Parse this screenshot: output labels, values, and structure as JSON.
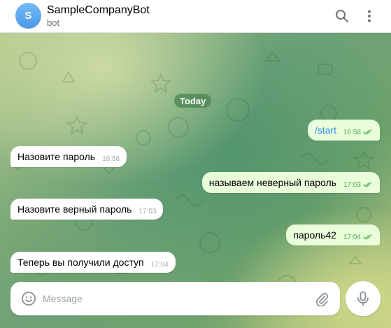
{
  "header": {
    "avatar_letter": "S",
    "title": "SampleCompanyBot",
    "subtitle": "bot",
    "icons": [
      "search-icon",
      "more-vertical-icon"
    ]
  },
  "chat": {
    "date_label": "Today",
    "messages": [
      {
        "dir": "out",
        "text": "/start",
        "time": "16:58",
        "status": "read"
      },
      {
        "dir": "in",
        "text": "Назовите пароль",
        "time": "16:58"
      },
      {
        "dir": "out",
        "text": "называем неверный пароль",
        "time": "17:03",
        "status": "read"
      },
      {
        "dir": "in",
        "text": "Назовите верный пароль",
        "time": "17:03"
      },
      {
        "dir": "out",
        "text": "пароль42",
        "time": "17:04",
        "status": "read"
      },
      {
        "dir": "in",
        "text": "Теперь вы получили доступ",
        "time": "17:04"
      }
    ]
  },
  "composer": {
    "placeholder": "Message",
    "value": "",
    "icons": [
      "emoji-icon",
      "paperclip-icon",
      "microphone-icon"
    ]
  },
  "colors": {
    "avatar": "#5aa7ee",
    "outgoing_bubble": "#e9fddb",
    "incoming_bubble": "#ffffff",
    "command_link": "#3390ec",
    "read_ticks": "#4fae4e"
  }
}
